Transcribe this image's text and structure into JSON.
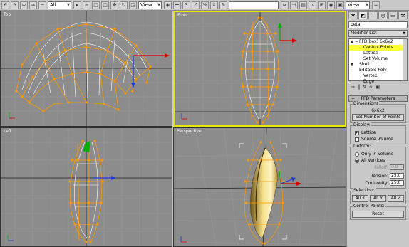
{
  "toolbar": {
    "filter_select": "All",
    "ref_coord_select": "View",
    "center_select": "View"
  },
  "viewports": {
    "top": "Top",
    "front": "Front",
    "left": "Left",
    "perspective": "Perspective"
  },
  "panel": {
    "object_name": "petal",
    "modifier_list": "Modifier List",
    "stack": [
      {
        "label": "FFD(box) 6x6x2"
      },
      {
        "label": "Control Points"
      },
      {
        "label": "Lattice"
      },
      {
        "label": "Set Volume"
      },
      {
        "label": "Shell"
      },
      {
        "label": "Editable Poly"
      },
      {
        "label": "Vertex"
      },
      {
        "label": "Edge"
      }
    ],
    "ffd": {
      "rollout_title": "FFD Parameters",
      "dimensions": {
        "title": "Dimensions",
        "value": "6x6x2",
        "set_button": "Set Number of Points"
      },
      "display": {
        "title": "Display:",
        "lattice": "Lattice",
        "source_volume": "Source Volume"
      },
      "deform": {
        "title": "Deform:",
        "only_in_volume": "Only In Volume",
        "all_vertices": "All Vertices",
        "falloff_label": "Falloff:",
        "falloff_value": "0.0",
        "tension_label": "Tension:",
        "tension_value": "25.0",
        "continuity_label": "Continuity:",
        "continuity_value": "25.0"
      },
      "selection": {
        "title": "Selection:",
        "allx": "All X",
        "ally": "All Y",
        "allz": "All Z"
      },
      "control_points": {
        "title": "Control Points:",
        "reset": "Reset"
      }
    }
  },
  "colors": {
    "viewport_bg": "#8c8c8c",
    "lattice": "#ff9900",
    "active_border": "#e8e800",
    "stack_highlight": "#ffff3a"
  }
}
